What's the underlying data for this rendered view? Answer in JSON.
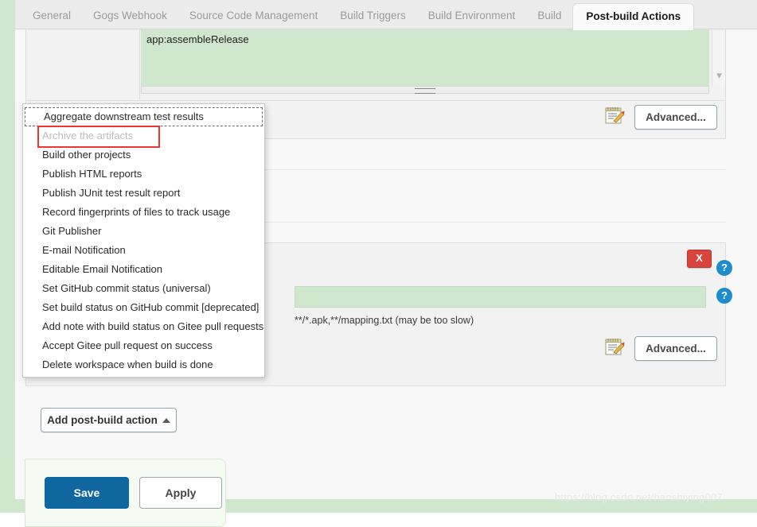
{
  "tabs": [
    {
      "label": "General",
      "active": false
    },
    {
      "label": "Gogs Webhook",
      "active": false
    },
    {
      "label": "Source Code Management",
      "active": false
    },
    {
      "label": "Build Triggers",
      "active": false
    },
    {
      "label": "Build Environment",
      "active": false
    },
    {
      "label": "Build",
      "active": false
    },
    {
      "label": "Post-build Actions",
      "active": true
    }
  ],
  "build_step": {
    "tasks_value": "app:assembleRelease",
    "advanced_label": "Advanced...",
    "notepad_icon": "notepad-pencil-icon",
    "scroll_down_icon": "chevron-down-icon"
  },
  "archive_block": {
    "delete_label": "X",
    "help_label": "?",
    "files_value": "",
    "hint": "**/*.apk,**/mapping.txt (may be too slow)",
    "advanced_label": "Advanced...",
    "notepad_icon": "notepad-pencil-icon"
  },
  "dropdown": {
    "items": [
      {
        "label": "Aggregate downstream test results",
        "state": "focused"
      },
      {
        "label": "Archive the artifacts",
        "state": "disabled"
      },
      {
        "label": "Build other projects",
        "state": "normal"
      },
      {
        "label": "Publish HTML reports",
        "state": "normal"
      },
      {
        "label": "Publish JUnit test result report",
        "state": "normal"
      },
      {
        "label": "Record fingerprints of files to track usage",
        "state": "normal"
      },
      {
        "label": "Git Publisher",
        "state": "normal"
      },
      {
        "label": "E-mail Notification",
        "state": "normal"
      },
      {
        "label": "Editable Email Notification",
        "state": "normal"
      },
      {
        "label": "Set GitHub commit status (universal)",
        "state": "normal"
      },
      {
        "label": "Set build status on GitHub commit [deprecated]",
        "state": "normal"
      },
      {
        "label": "Add note with build status on Gitee pull requests",
        "state": "normal"
      },
      {
        "label": "Accept Gitee pull request on success",
        "state": "normal"
      },
      {
        "label": "Delete workspace when build is done",
        "state": "normal"
      }
    ]
  },
  "add_action": {
    "label": "Add post-build action",
    "caret_icon": "caret-up-icon"
  },
  "savebar": {
    "save_label": "Save",
    "apply_label": "Apply"
  },
  "watermark": {
    "text": "https://blog.csdn.net/hanshiying007"
  },
  "colors": {
    "accent_blue": "#1067a0",
    "help_blue": "#1e8bcd",
    "delete_red": "#d9453c",
    "annotation_red": "#e8372c",
    "field_green": "#cfe7cd",
    "tabbar_grey": "#ececec"
  }
}
